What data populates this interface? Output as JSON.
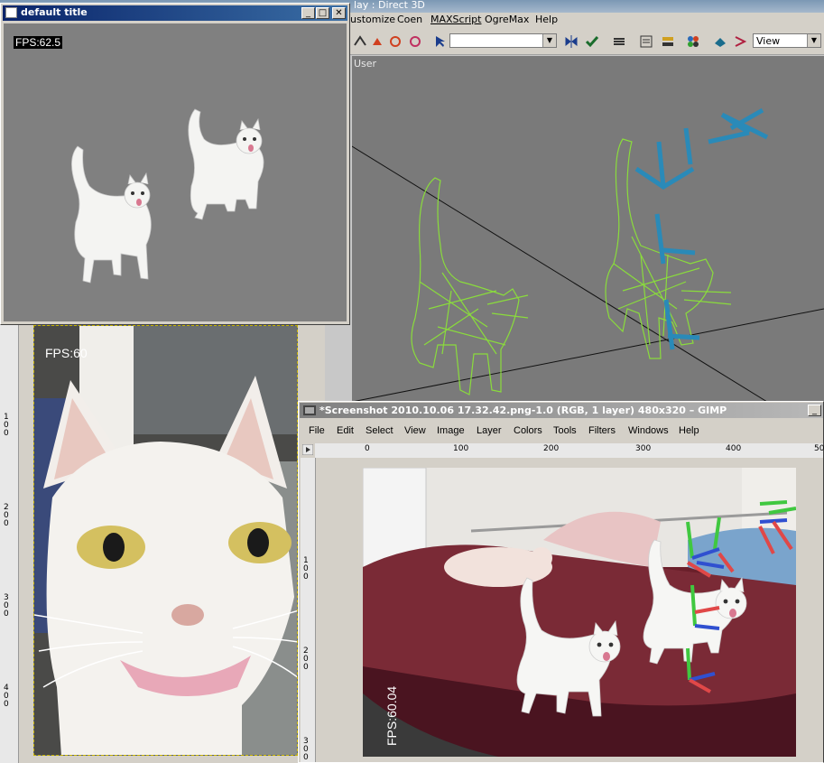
{
  "max": {
    "title": "lay : Direct 3D",
    "menu": [
      "ustomize",
      "Coen",
      "MAXScript",
      "OgreMax",
      "Help"
    ],
    "toolbar_select_value": "",
    "view_select": "View",
    "viewport_label": "User"
  },
  "ogre": {
    "title": "default title",
    "fps": "FPS:62.5",
    "buttons": {
      "minimize": "_",
      "maximize": "□",
      "close": "✕"
    }
  },
  "left_viewer": {
    "fps": "FPS:60",
    "ruler_marks": [
      "1\n0\n0",
      "2\n0\n0",
      "3\n0\n0",
      "4\n0\n0"
    ]
  },
  "gimp": {
    "title": "*Screenshot 2010.10.06 17.32.42.png-1.0 (RGB, 1 layer) 480x320 – GIMP",
    "menu": [
      "File",
      "Edit",
      "Select",
      "View",
      "Image",
      "Layer",
      "Colors",
      "Tools",
      "Filters",
      "Windows",
      "Help"
    ],
    "hruler": [
      "0",
      "100",
      "200",
      "300",
      "400",
      "50"
    ],
    "vruler": [
      "1\n0\n0",
      "2\n0\n0",
      "3\n0\n0"
    ],
    "fps": "FPS:60.04"
  },
  "colors": {
    "wire_green": "#8adc3c",
    "bone_blue": "#2a8ab8",
    "titlebar_blue": "#0a246a",
    "viewport_gray": "#7a7a7a"
  }
}
